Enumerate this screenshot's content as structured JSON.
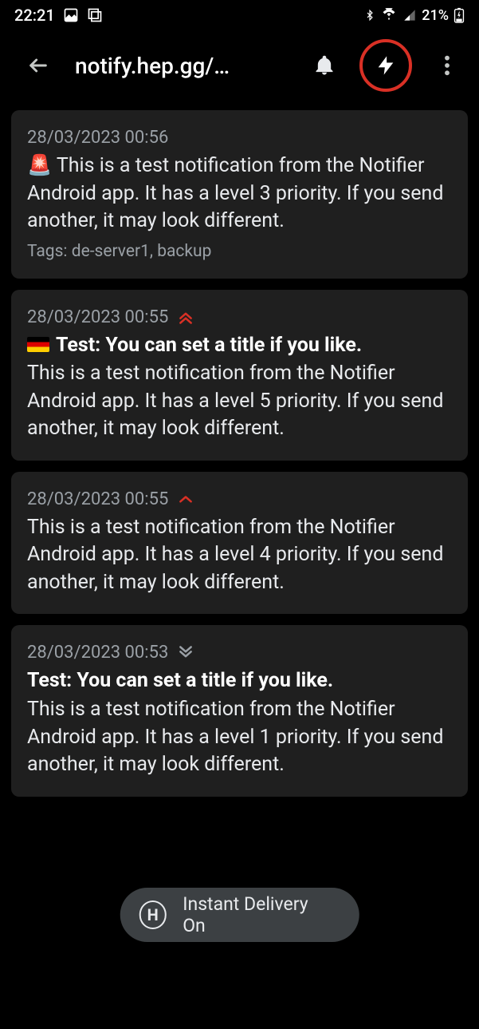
{
  "status": {
    "time": "22:21",
    "battery": "21%"
  },
  "appbar": {
    "title": "notify.hep.gg/…"
  },
  "toast": {
    "text": "Instant Delivery On"
  },
  "notifications": [
    {
      "date": "28/03/2023 00:56",
      "priority_indicator": "siren",
      "body": "🚨 This is a test notification from the Notifier Android app. It has a level 3 priority. If you send another, it may look different.",
      "tags_label": "Tags: de-server1, backup"
    },
    {
      "date": "28/03/2023 00:55",
      "priority_indicator": "double-chevron-red",
      "title_flag": "de",
      "title": "Test: You can set a title if you like.",
      "body": "This is a test notification from the Notifier Android app. It has a level 5 priority. If you send another, it may look different."
    },
    {
      "date": "28/03/2023 00:55",
      "priority_indicator": "single-chevron-red",
      "body": "This is a test notification from the Notifier Android app. It has a level 4 priority. If you send another, it may look different."
    },
    {
      "date": "28/03/2023 00:53",
      "priority_indicator": "double-chevron-down-grey",
      "title": "Test: You can set a title if you like.",
      "body": "This is a test notification from the Notifier Android app. It has a level 1 priority. If you send another, it may look different."
    }
  ]
}
